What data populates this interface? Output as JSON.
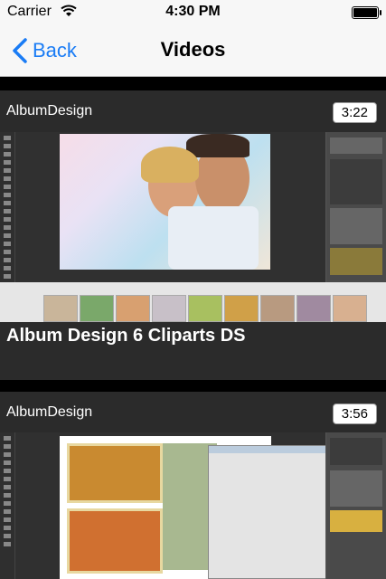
{
  "status_bar": {
    "carrier": "Carrier",
    "time": "4:30 PM",
    "battery_level": 1.0
  },
  "nav": {
    "back_label": "Back",
    "title": "Videos"
  },
  "videos": [
    {
      "channel": "AlbumDesign",
      "duration": "3:22",
      "title": "Album Design 6 Cliparts DS"
    },
    {
      "channel": "AlbumDesign",
      "duration": "3:56",
      "title": ""
    }
  ],
  "colors": {
    "accent": "#1a7cf5",
    "list_background": "#2b2b2b",
    "separator": "#000000"
  }
}
